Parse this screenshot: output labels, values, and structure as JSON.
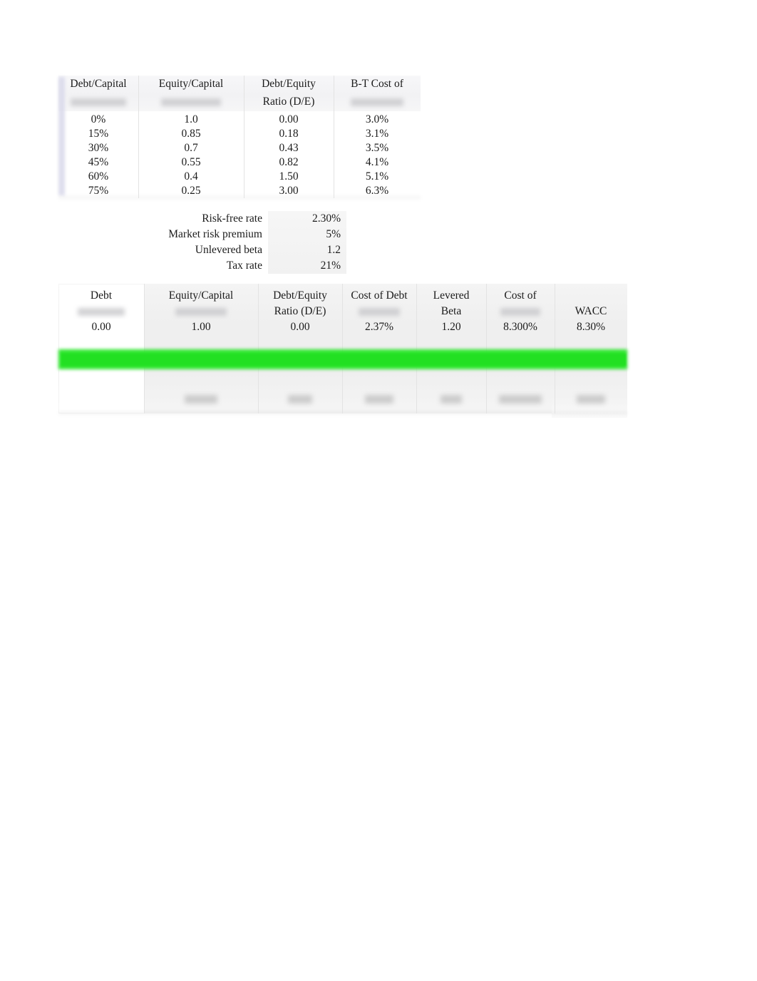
{
  "document": {
    "kind": "spreadsheet-screenshot",
    "background_color": "#ffffff",
    "highlight_color": "#2fe62f"
  },
  "top_table": {
    "name": "capital-structure-assumptions",
    "headers_line1": [
      "Debt/Capital",
      "Equity/Capital",
      "Debt/Equity",
      "B-T Cost of"
    ],
    "headers_line2": [
      "",
      "",
      "Ratio (D/E)",
      ""
    ],
    "headers_line2_blurred": [
      true,
      true,
      false,
      true
    ],
    "rows": [
      [
        "0%",
        "1.0",
        "0.00",
        "3.0%"
      ],
      [
        "15%",
        "0.85",
        "0.18",
        "3.1%"
      ],
      [
        "30%",
        "0.7",
        "0.43",
        "3.5%"
      ],
      [
        "45%",
        "0.55",
        "0.82",
        "4.1%"
      ],
      [
        "60%",
        "0.4",
        "1.50",
        "5.1%"
      ],
      [
        "75%",
        "0.25",
        "3.00",
        "6.3%"
      ]
    ]
  },
  "parameters": {
    "name": "model-inputs",
    "items": [
      {
        "label": "Risk-free rate",
        "value": "2.30%"
      },
      {
        "label": "Market risk premium",
        "value": "5%"
      },
      {
        "label": "Unlevered beta",
        "value": "1.2"
      },
      {
        "label": "Tax rate",
        "value": "21%"
      }
    ]
  },
  "bottom_table": {
    "name": "wacc-calculation",
    "headers_line1": [
      "Debt",
      "Equity/Capital",
      "Debt/Equity",
      "Cost of Debt",
      "Levered",
      "Cost of",
      ""
    ],
    "headers_line2": [
      "",
      "",
      "Ratio (D/E)",
      "",
      "Beta",
      "",
      "WACC"
    ],
    "headers_line2_blurred": [
      true,
      true,
      false,
      true,
      false,
      true,
      false
    ],
    "first_row": [
      "0.00",
      "1.00",
      "0.00",
      "2.37%",
      "1.20",
      "8.300%",
      "8.30%"
    ],
    "last_row": [
      "",
      "",
      "",
      "",
      "",
      "",
      ""
    ],
    "last_row_blurred": [
      false,
      true,
      true,
      true,
      true,
      true,
      true
    ],
    "highlighted_row_index": 1
  }
}
